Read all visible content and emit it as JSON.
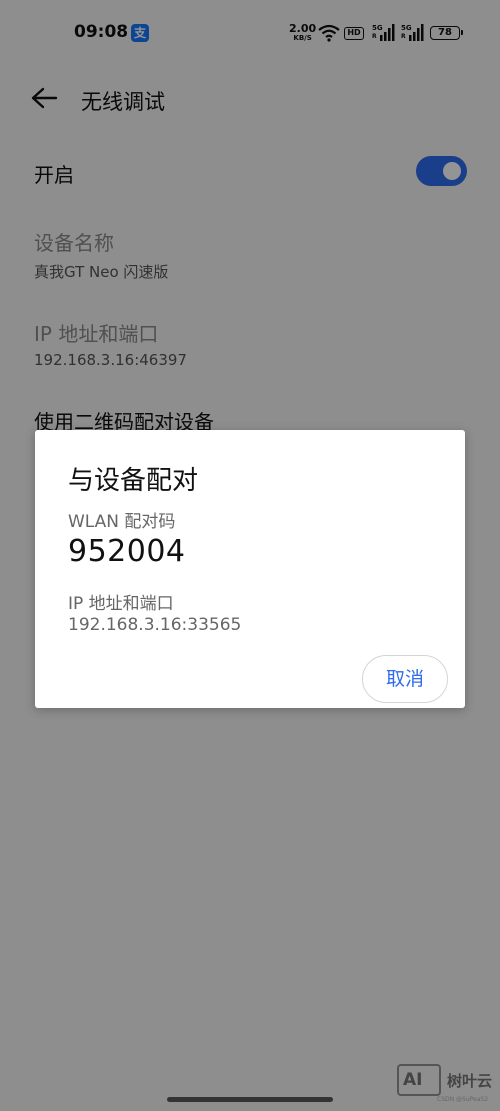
{
  "status_bar": {
    "time": "09:08",
    "alipay_glyph": "支",
    "speed_value": "2.00",
    "speed_unit": "KB/S",
    "hd_label": "HD",
    "sim1_gen": "5G",
    "sim1_r": "R",
    "sim2_gen": "5G",
    "sim2_r": "R",
    "battery": "78"
  },
  "header": {
    "title": "无线调试",
    "back_icon": "arrow-left-icon"
  },
  "settings": {
    "enable_label": "开启",
    "enable_state": true,
    "device_name_title": "设备名称",
    "device_name_value": "真我GT Neo 闪速版",
    "ip_title": "IP 地址和端口",
    "ip_value": "192.168.3.16:46397",
    "qr_pair_title": "使用二维码配对设备"
  },
  "dialog": {
    "title": "与设备配对",
    "code_label": "WLAN 配对码",
    "code": "952004",
    "addr_label": "IP 地址和端口",
    "addr_value": "192.168.3.16:33565",
    "cancel_label": "取消"
  },
  "watermark": {
    "box": "AI",
    "text": "树叶云",
    "sub": "CSDN @SuPeaS2"
  },
  "colors": {
    "accent": "#2f6bf0",
    "overlay": "rgba(0,0,0,0.42)"
  }
}
